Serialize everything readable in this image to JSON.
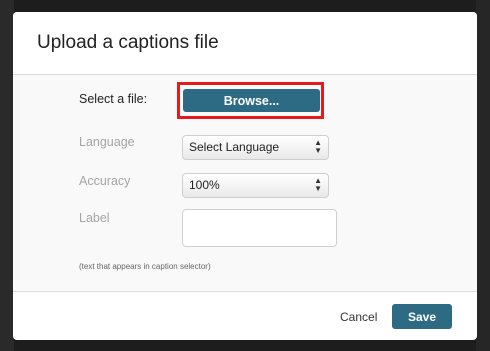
{
  "dialog": {
    "title": "Upload a captions file",
    "file_label": "Select a file:",
    "browse_label": "Browse...",
    "language_label": "Language",
    "language_value": "Select Language",
    "accuracy_label": "Accuracy",
    "accuracy_value": "100%",
    "label_label": "Label",
    "label_value": "",
    "hint": "(text that appears in caption selector)",
    "cancel_label": "Cancel",
    "save_label": "Save"
  },
  "colors": {
    "primary_button": "#2d6b85",
    "highlight": "#e51a1a"
  },
  "icons": {
    "select_arrows": "chevron-updown-icon"
  }
}
